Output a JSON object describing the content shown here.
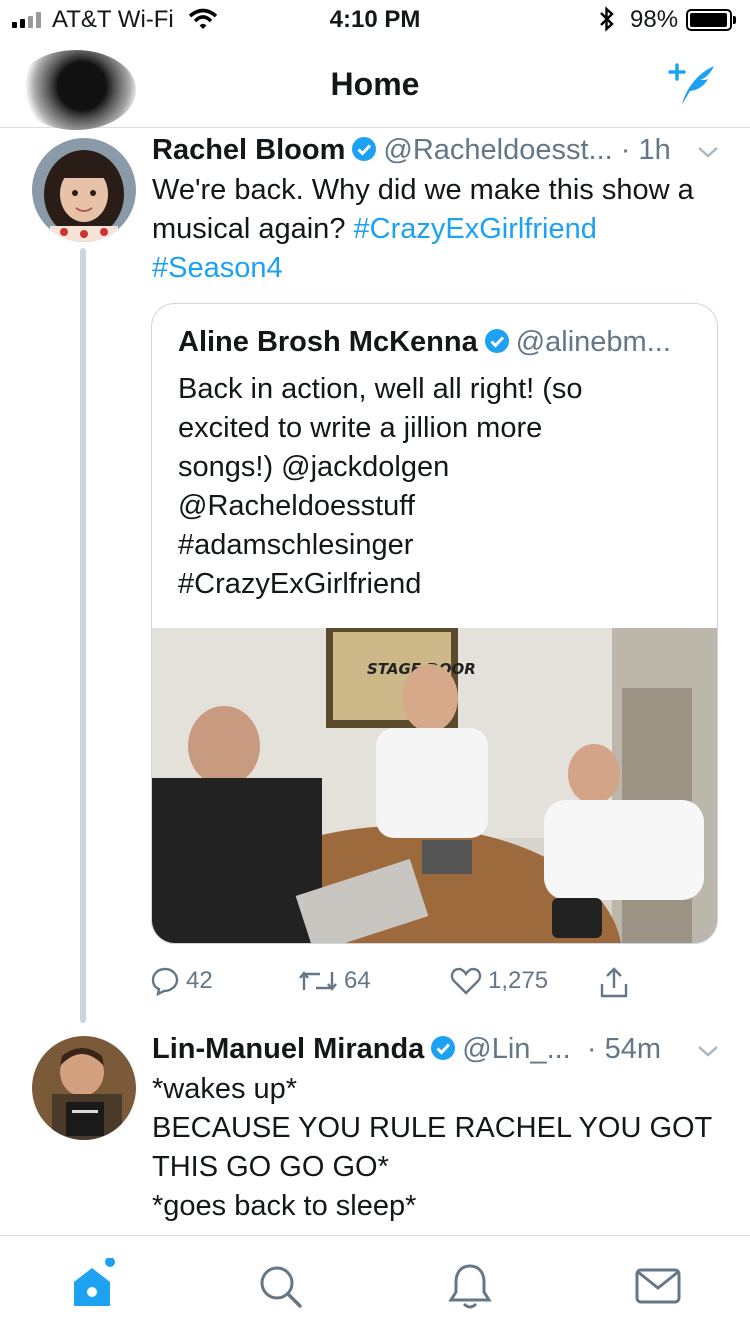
{
  "status_bar": {
    "carrier": "AT&T Wi-Fi",
    "time": "4:10 PM",
    "battery": "98%",
    "battery_level": 0.98
  },
  "nav": {
    "title": "Home",
    "compose_icon": "compose-tweet-icon"
  },
  "tweet1": {
    "name": "Rachel Bloom",
    "handle": "@Racheldoesst...",
    "time": "· 1h",
    "text_plain": "We're back. Why did we make this show a musical again? ",
    "hashtag1": "#CrazyExGirlfriend",
    "hashtag2": "#Season4",
    "quote": {
      "name": "Aline Brosh McKenna",
      "handle": "@alinebm...",
      "lines": [
        "Back in action, well all right! (so",
        "excited to write a jillion more",
        "songs!) @jackdolgen",
        "@Racheldoesstuff",
        "#adamschlesinger",
        "#CrazyExGirlfriend"
      ],
      "poster_text": "STAGE DOOR"
    },
    "replies": "42",
    "retweets": "64",
    "likes": "1,275"
  },
  "tweet2": {
    "name": "Lin-Manuel Miranda",
    "handle": "@Lin_...",
    "time": "· 54m",
    "lines": [
      "*wakes up*",
      "BECAUSE YOU RULE RACHEL YOU GOT",
      "THIS GO GO GO*",
      "*goes back to sleep*"
    ]
  },
  "colors": {
    "accent": "#1da1f2",
    "secondary_text": "#657786",
    "border": "#ccd6dd"
  },
  "tabs": [
    "home-icon",
    "search-icon",
    "notifications-icon",
    "messages-icon"
  ]
}
